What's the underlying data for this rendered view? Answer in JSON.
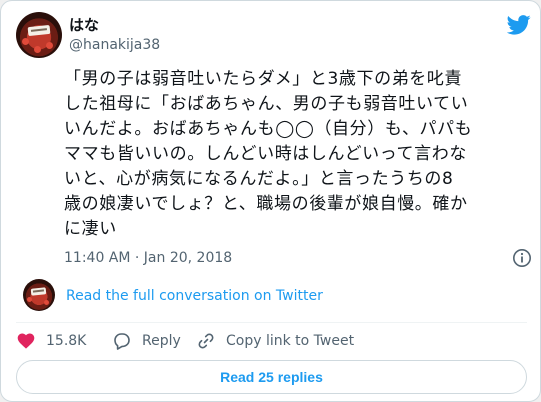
{
  "author": {
    "name": "はな",
    "handle": "@hanakija38"
  },
  "tweet": {
    "text": "「男の子は弱音吐いたらダメ」と3歳下の弟を叱責\nした祖母に「おばあちゃん、男の子も弱音吐いてい\nいんだよ。おばあちゃんも◯◯（自分）も、パパも\nママも皆いいの。しんどい時はしんどいって言わな\nいと、心が病気になるんだよ。」と言ったうちの8\n歳の娘凄いでしょ？と、職場の後輩が娘自慢。確か\nに凄い",
    "timestamp": "11:40 AM · Jan 20, 2018"
  },
  "conversation": {
    "link_text": "Read the full conversation on Twitter"
  },
  "actions": {
    "likes_count": "15.8K",
    "reply_label": "Reply",
    "copy_link_label": "Copy link to Tweet"
  },
  "read_replies": {
    "label": "Read 25 replies"
  },
  "icons": {
    "brand": "twitter-bird-icon",
    "info": "info-icon",
    "like": "heart-icon",
    "reply": "speech-bubble-icon",
    "copy": "link-icon"
  },
  "colors": {
    "accent": "#1d9bf0",
    "heart": "#e0245e",
    "secondary_text": "#536471"
  }
}
